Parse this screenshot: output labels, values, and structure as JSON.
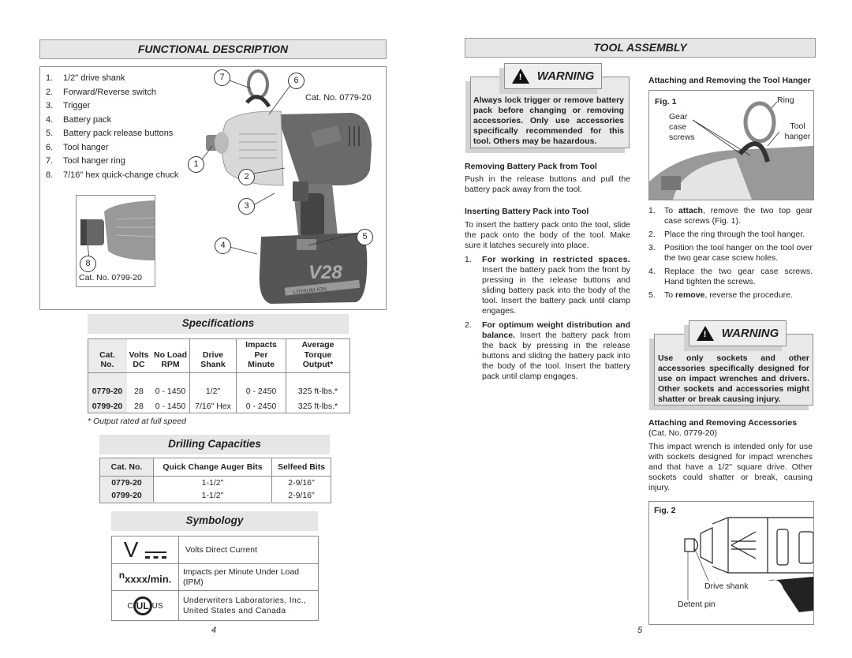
{
  "left_page": {
    "title": "FUNCTIONAL DESCRIPTION",
    "parts": [
      {
        "num": "1.",
        "label": "1/2\" drive shank"
      },
      {
        "num": "2.",
        "label": "Forward/Reverse switch"
      },
      {
        "num": "3.",
        "label": "Trigger"
      },
      {
        "num": "4.",
        "label": "Battery pack"
      },
      {
        "num": "5.",
        "label": "Battery pack release buttons"
      },
      {
        "num": "6.",
        "label": "Tool hanger"
      },
      {
        "num": "7.",
        "label": "Tool hanger ring"
      },
      {
        "num": "8.",
        "label": "7/16\" hex quick-change chuck"
      }
    ],
    "main_figure_cat": "Cat. No. 0779-20",
    "inset_figure_cat": "Cat. No. 0799-20",
    "callouts": [
      "1",
      "2",
      "3",
      "4",
      "5",
      "6",
      "7",
      "8"
    ],
    "battery_label": "V28",
    "battery_sub": "LITHIUM-ION",
    "specifications": {
      "title": "Specifications",
      "headers": [
        [
          "Cat.",
          "No."
        ],
        [
          "Volts",
          "DC"
        ],
        [
          "No Load",
          "RPM"
        ],
        [
          "Drive",
          "Shank"
        ],
        [
          "Impacts",
          "Per",
          "Minute"
        ],
        [
          "Average",
          "Torque",
          "Output*"
        ]
      ],
      "rows": [
        [
          "0779-20",
          "28",
          "0 - 1450",
          "1/2\"",
          "0 - 2450",
          "325 ft-lbs.*"
        ],
        [
          "0799-20",
          "28",
          "0 - 1450",
          "7/16\" Hex",
          "0 - 2450",
          "325 ft-lbs.*"
        ]
      ],
      "footnote": "* Output rated at full speed"
    },
    "drilling": {
      "title": "Drilling Capacities",
      "headers": [
        "Cat. No.",
        "Quick Change Auger Bits",
        "Selfeed Bits"
      ],
      "rows": [
        [
          "0779-20",
          "1-1/2\"",
          "2-9/16\""
        ],
        [
          "0799-20",
          "1-1/2\"",
          "2-9/16\""
        ]
      ]
    },
    "symbology": {
      "title": "Symbology",
      "rows": [
        {
          "symbol": "V",
          "desc": "Volts Direct Current"
        },
        {
          "symbol_sup": "n",
          "symbol": "xxxx/min.",
          "desc": "Impacts per Minute Under Load (IPM)"
        },
        {
          "symbol_c": "C",
          "symbol": "UL",
          "symbol_us": "US",
          "desc": "Underwriters Laboratories, Inc., United States and Canada"
        }
      ]
    },
    "page_number": "4"
  },
  "right_page": {
    "title": "TOOL ASSEMBLY",
    "warning1": {
      "label": "WARNING",
      "text": "Always lock trigger or remove battery pack before changing or removing accessories. Only use accessories specifically recommended for this tool. Others may be hazardous."
    },
    "removing_battery": {
      "heading": "Removing Battery Pack from Tool",
      "text": "Push in the release buttons and pull the battery pack away from the tool."
    },
    "inserting_battery": {
      "heading": "Inserting Battery Pack into Tool",
      "text": "To insert the battery pack onto the tool, slide the pack onto the body of the tool. Make sure it latches securely into place.",
      "steps": [
        {
          "num": "1.",
          "bold": "For working in restricted spaces.",
          "text": " Insert the battery pack from the front by pressing in the release buttons and sliding battery pack into the body of the tool. Insert the battery pack until clamp engages."
        },
        {
          "num": "2.",
          "bold": "For optimum weight distribution and balance.",
          "text": " Insert the battery pack from the back by pressing in the release buttons and sliding the battery pack into the body of the tool. Insert the battery pack until clamp engages."
        }
      ]
    },
    "tool_hanger": {
      "heading": "Attaching and Removing the Tool Hanger",
      "fig_label": "Fig. 1",
      "fig_labels": {
        "ring": "Ring",
        "gear": "Gear case screws",
        "hanger": "Tool hanger"
      },
      "steps": [
        {
          "num": "1.",
          "pre": "To ",
          "bold": "attach",
          "post": ", remove the two top gear case screws (Fig. 1)."
        },
        {
          "num": "2.",
          "pre": "Place the ring through the tool hanger.",
          "bold": "",
          "post": ""
        },
        {
          "num": "3.",
          "pre": "Position the tool hanger on the tool over the two gear case screw holes.",
          "bold": "",
          "post": ""
        },
        {
          "num": "4.",
          "pre": "Replace the two gear case screws. Hand tighten the screws.",
          "bold": "",
          "post": ""
        },
        {
          "num": "5.",
          "pre": "To ",
          "bold": "remove",
          "post": ", reverse the procedure."
        }
      ]
    },
    "warning2": {
      "label": "WARNING",
      "text": "Use only sockets and other accessories specifically designed for use on impact wrenches and drivers. Other sockets and accessories might shatter or break causing injury."
    },
    "accessories": {
      "heading": "Attaching and Removing Accessories",
      "subheading": "(Cat. No. 0779-20)",
      "text": "This impact wrench is intended only for use with sockets designed for impact wrenches and that have a 1/2\" square drive. Other sockets could shatter or break, causing injury.",
      "fig_label": "Fig. 2",
      "fig_labels": {
        "drive": "Drive shank",
        "detent": "Detent pin"
      }
    },
    "page_number": "5"
  }
}
